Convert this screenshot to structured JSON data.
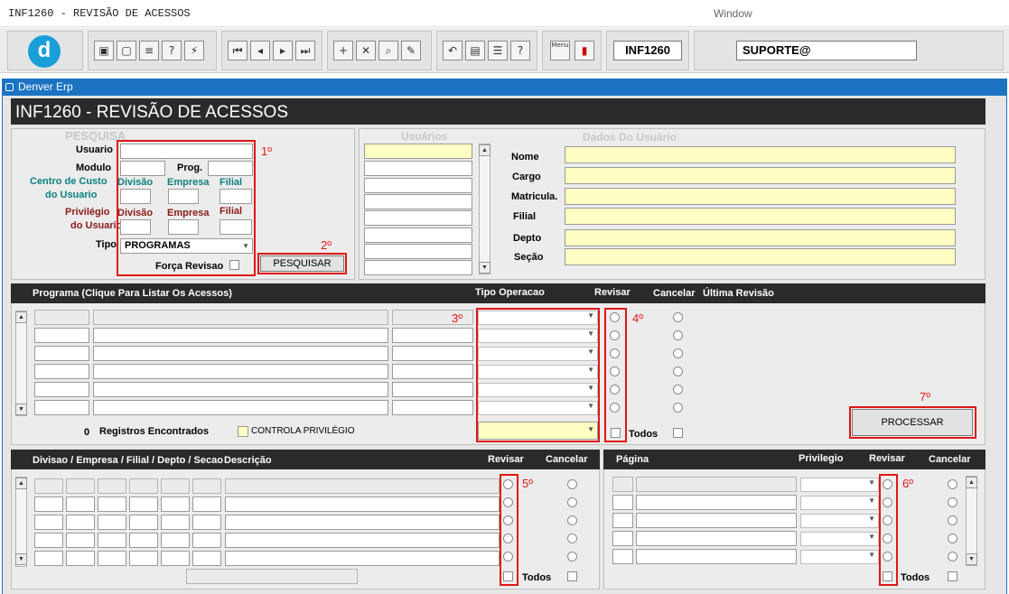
{
  "window": {
    "title": "INF1260 - REVISÃO DE ACESSOS",
    "menu_label": "Window"
  },
  "toolbar": {
    "logo": "d",
    "form_code": "INF1260",
    "user": "SUPORTE@",
    "menu_icon_text": "Menu"
  },
  "app": {
    "tab_title": "Denver Erp",
    "page_title": "INF1260 - REVISÃO DE ACESSOS"
  },
  "pesquisa": {
    "heading": "PESQUISA",
    "usuario": "Usuario",
    "modulo": "Modulo",
    "prog": "Prog.",
    "cc_line1": "Centro de Custo",
    "cc_line2": "do Usuario",
    "divisao": "Divisão",
    "empresa": "Empresa",
    "filial": "Filial",
    "priv_line1": "Privilégio",
    "priv_line2": "do Usuario",
    "tipo": "Tipo",
    "tipo_value": "PROGRAMAS",
    "forca_revisao": "Força Revisao",
    "pesquisar": "PESQUISAR"
  },
  "usuarios": {
    "heading": "Usuários"
  },
  "dados": {
    "heading": "Dados Do Usuário",
    "nome": "Nome",
    "cargo": "Cargo",
    "matricula": "Matricula.",
    "filial": "Filial",
    "depto": "Depto",
    "secao": "Seção"
  },
  "programas": {
    "header": "Programa (Clique Para Listar Os Acessos)",
    "tipo_operacao": "Tipo Operacao",
    "revisar": "Revisar",
    "cancelar": "Cancelar",
    "ultima_revisao": "Última Revisão",
    "count": "0",
    "registros": "Registros Encontrados",
    "controla_privilegio": "CONTROLA PRIVILÉGIO",
    "todos": "Todos",
    "processar": "PROCESSAR"
  },
  "divisao": {
    "header": "Divisao / Empresa / Filial / Depto / Secao",
    "descricao": "Descrição",
    "revisar": "Revisar",
    "cancelar": "Cancelar",
    "todos": "Todos"
  },
  "pagina": {
    "header": "Página",
    "privilegio": "Privilegio",
    "revisar": "Revisar",
    "cancelar": "Cancelar",
    "todos": "Todos"
  },
  "annotations": [
    "1º",
    "2º",
    "3º",
    "4º",
    "5º",
    "6º",
    "7º"
  ],
  "colors": {
    "accent": "#1b73c2",
    "header_dark": "#2a2a2a",
    "highlight_yellow": "#ffffc4",
    "annotation_red": "#e01616"
  }
}
